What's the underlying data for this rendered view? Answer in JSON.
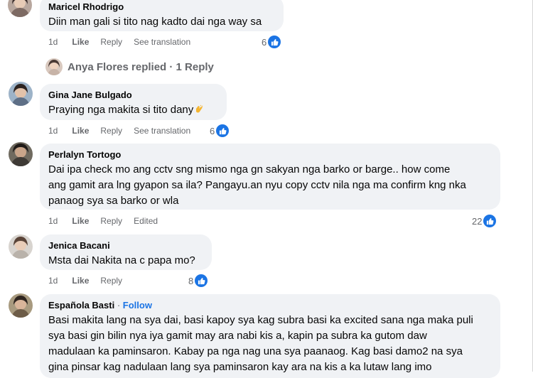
{
  "comments": [
    {
      "author": "Maricel Rhodrigo",
      "text": "Diin man gali si tito nag kadto dai nga way sa",
      "time": "1d",
      "like": "Like",
      "reply": "Reply",
      "extra": "See translation",
      "reaction_count": "6"
    },
    {
      "author": "Gina Jane Bulgado",
      "text": "Praying nga makita si tito dany",
      "time": "1d",
      "like": "Like",
      "reply": "Reply",
      "extra": "See translation",
      "reaction_count": "6"
    },
    {
      "author": "Perlalyn Tortogo",
      "text_lines": [
        "Dai ipa check mo ang cctv sng mismo nga gn sakyan nga barko or barge.. how come",
        "ang gamit ara lng gyapon sa ila? Pangayu.an nyu copy cctv nila nga ma confirm kng nka",
        "panaog sya sa barko or wla"
      ],
      "time": "1d",
      "like": "Like",
      "reply": "Reply",
      "extra": "Edited",
      "reaction_count": "22"
    },
    {
      "author": "Jenica Bacani",
      "text": "Msta dai Nakita na c papa mo?",
      "time": "1d",
      "like": "Like",
      "reply": "Reply",
      "reaction_count": "8"
    },
    {
      "author": "Española Basti",
      "follow": "Follow",
      "text_lines": [
        "Basi makita lang na sya dai, basi kapoy sya kag subra basi ka excited sana nga maka puli",
        "sya basi gin bilin nya iya gamit may ara nabi kis a, kapin pa subra ka gutom daw",
        "madulaan ka paminsaron. Kabay pa nga nag una sya paanaog. Kag basi damo2 na sya",
        "gina pinsar kag nadulaan lang sya paminsaron kay ara na kis a ka lutaw lang imo"
      ]
    }
  ],
  "reply_summary": {
    "text": "Anya Flores replied · 1 Reply"
  },
  "colors": {
    "bubble": "#f0f2f5",
    "meta": "#65676b",
    "like_blue": "#1b74e4"
  }
}
